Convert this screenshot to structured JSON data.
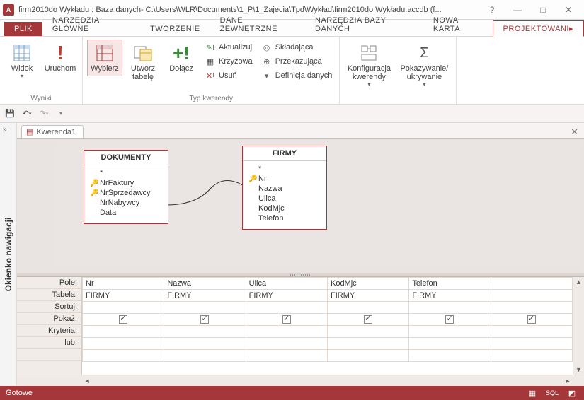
{
  "titlebar": {
    "app_icon_text": "A",
    "title": "firm2010do Wykładu : Baza danych- C:\\Users\\WLR\\Documents\\1_P\\1_Zajecia\\Tpd\\Wykład\\firm2010do Wykładu.accdb (f..."
  },
  "tabs": {
    "file": "PLIK",
    "items": [
      "NARZĘDZIA GŁÓWNE",
      "TWORZENIE",
      "DANE ZEWNĘTRZNE",
      "NARZĘDZIA BAZY DANYCH",
      "Nowa karta"
    ],
    "active": "PROJEKTOWANI"
  },
  "ribbon": {
    "groups": {
      "wyniki": {
        "label": "Wyniki",
        "widok": "Widok",
        "uruchom": "Uruchom"
      },
      "typ": {
        "label": "Typ kwerendy",
        "wybierz": "Wybierz",
        "utworz": "Utwórz tabelę",
        "dolacz": "Dołącz",
        "aktualizuj": "Aktualizuj",
        "krzyzowa": "Krzyżowa",
        "usun": "Usuń",
        "skladajaca": "Składająca",
        "przekazujaca": "Przekazująca",
        "definicja": "Definicja danych"
      },
      "konf": {
        "label": "",
        "konfiguracja": "Konfiguracja kwerendy",
        "pokazywanie": "Pokazywanie/ ukrywanie"
      }
    }
  },
  "navpane": {
    "label": "Okienko nawigacji"
  },
  "doctab": {
    "name": "Kwerenda1"
  },
  "diagram": {
    "tables": {
      "dokumenty": {
        "title": "DOKUMENTY",
        "star": "*",
        "fields": [
          {
            "key": true,
            "name": "NrFaktury"
          },
          {
            "key": true,
            "name": "NrSprzedawcy"
          },
          {
            "key": false,
            "name": "NrNabywcy"
          },
          {
            "key": false,
            "name": "Data"
          }
        ]
      },
      "firmy": {
        "title": "FIRMY",
        "star": "*",
        "fields": [
          {
            "key": true,
            "name": "Nr"
          },
          {
            "key": false,
            "name": "Nazwa"
          },
          {
            "key": false,
            "name": "Ulica"
          },
          {
            "key": false,
            "name": "KodMjc"
          },
          {
            "key": false,
            "name": "Telefon"
          }
        ]
      }
    }
  },
  "grid": {
    "rowlabels": [
      "Pole:",
      "Tabela:",
      "Sortuj:",
      "Pokaż:",
      "Kryteria:",
      "lub:"
    ],
    "columns": [
      {
        "pole": "Nr",
        "tabela": "FIRMY",
        "pokaz": true
      },
      {
        "pole": "Nazwa",
        "tabela": "FIRMY",
        "pokaz": true
      },
      {
        "pole": "Ulica",
        "tabela": "FIRMY",
        "pokaz": true
      },
      {
        "pole": "KodMjc",
        "tabela": "FIRMY",
        "pokaz": true
      },
      {
        "pole": "Telefon",
        "tabela": "FIRMY",
        "pokaz": true
      },
      {
        "pole": "",
        "tabela": "",
        "pokaz": true
      }
    ]
  },
  "statusbar": {
    "text": "Gotowe",
    "sql": "SQL"
  }
}
